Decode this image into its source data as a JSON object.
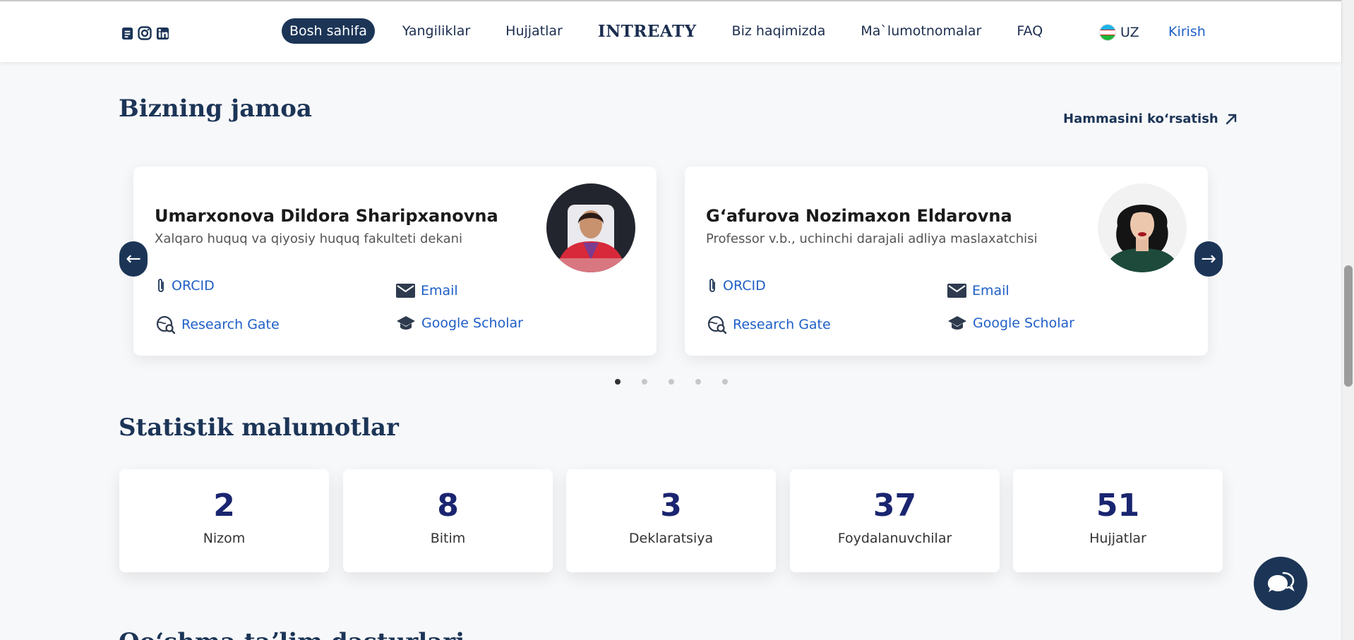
{
  "header": {
    "social_icons": [
      "document-icon",
      "instagram-icon",
      "linkedin-icon"
    ],
    "nav": [
      {
        "label": "Bosh sahifa",
        "active": true
      },
      {
        "label": "Yangiliklar"
      },
      {
        "label": "Hujjatlar"
      },
      {
        "label": "INTREATY",
        "brand": true
      },
      {
        "label": "Biz haqimizda"
      },
      {
        "label": "Ma`lumotnomalar"
      },
      {
        "label": "FAQ"
      }
    ],
    "language": "UZ",
    "login": "Kirish"
  },
  "team": {
    "title": "Bizning jamoa",
    "see_all": "Hammasini koʻrsatish",
    "members": [
      {
        "name": "Umarxonova Dildora Sharipxanovna",
        "role": "Xalqaro huquq va qiyosiy huquq fakulteti dekani",
        "links": {
          "orcid": "ORCID",
          "email": "Email",
          "research_gate": "Research Gate",
          "google_scholar": "Google Scholar"
        }
      },
      {
        "name": "Gʻafurova Nozimaxon Eldarovna",
        "role": "Professor v.b., uchinchi darajali adliya maslaxatchisi",
        "links": {
          "orcid": "ORCID",
          "email": "Email",
          "research_gate": "Research Gate",
          "google_scholar": "Google Scholar"
        }
      }
    ],
    "prev_arrow": "←",
    "next_arrow": "→",
    "pages": 5,
    "active_page": 1
  },
  "stats": {
    "title": "Statistik malumotlar",
    "items": [
      {
        "value": "2",
        "label": "Nizom"
      },
      {
        "value": "8",
        "label": "Bitim"
      },
      {
        "value": "3",
        "label": "Deklaratsiya"
      },
      {
        "value": "37",
        "label": "Foydalanuvchilar"
      },
      {
        "value": "51",
        "label": "Hujjatlar"
      }
    ]
  },
  "next_section_title": "Qoʻshma taʼlim dasturlari",
  "colors": {
    "primary": "#1c3557",
    "link": "#1f5fc7",
    "stat_number": "#1a2570"
  }
}
